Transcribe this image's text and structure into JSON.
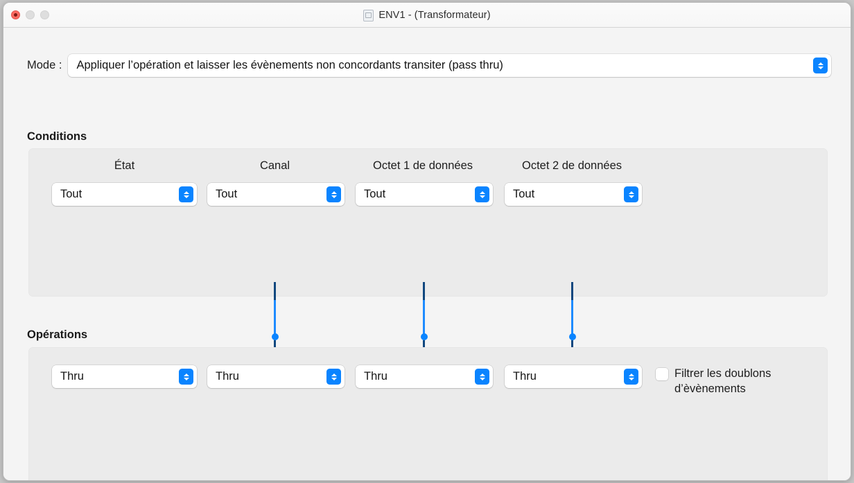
{
  "window": {
    "title": "ENV1 - (Transformateur)",
    "doc_icon": "document-icon",
    "traffic": {
      "close": "close-button",
      "minimize": "minimize-button",
      "zoom": "zoom-button"
    }
  },
  "mode": {
    "label": "Mode :",
    "value": "Appliquer l’opération et laisser les évènements non concordants transiter (pass thru)"
  },
  "conditions": {
    "heading": "Conditions",
    "columns": [
      {
        "header": "État",
        "value": "Tout"
      },
      {
        "header": "Canal",
        "value": "Tout"
      },
      {
        "header": "Octet 1 de données",
        "value": "Tout"
      },
      {
        "header": "Octet 2 de données",
        "value": "Tout"
      }
    ]
  },
  "operations": {
    "heading": "Opérations",
    "columns": [
      {
        "value": "Thru"
      },
      {
        "value": "Thru"
      },
      {
        "value": "Thru"
      },
      {
        "value": "Thru"
      }
    ],
    "filter_checkbox": {
      "label": "Filtrer les doublons\nd’èvènements",
      "checked": false
    }
  },
  "connectors": [
    {
      "name": "connector-channel"
    },
    {
      "name": "connector-data-byte-1"
    },
    {
      "name": "connector-data-byte-2"
    }
  ],
  "colors": {
    "accent": "#0a84ff",
    "connector_dark": "#11487f",
    "connector_light": "#1e8bff",
    "window_bg": "#f4f4f4",
    "panel_bg": "#ebebeb"
  }
}
